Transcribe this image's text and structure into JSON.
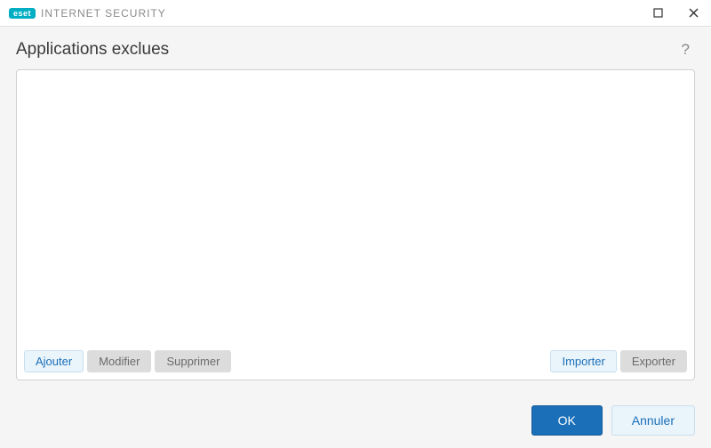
{
  "titlebar": {
    "logo_text": "eset",
    "product_name": "INTERNET SECURITY"
  },
  "header": {
    "title": "Applications exclues",
    "help_symbol": "?"
  },
  "list": {
    "items": []
  },
  "panel_actions": {
    "add": "Ajouter",
    "edit": "Modifier",
    "delete": "Supprimer",
    "import": "Importer",
    "export": "Exporter"
  },
  "footer": {
    "ok": "OK",
    "cancel": "Annuler"
  }
}
